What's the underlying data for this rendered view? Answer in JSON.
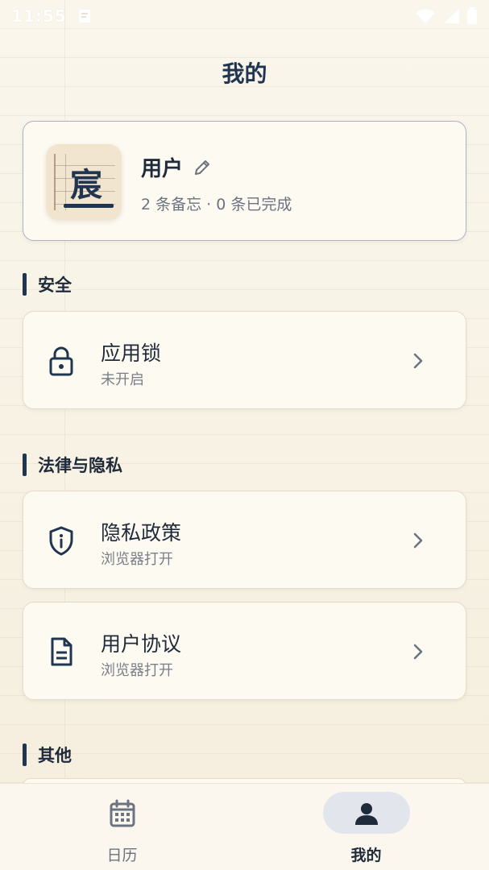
{
  "status_bar": {
    "time": "11:55"
  },
  "header": {
    "title": "我的"
  },
  "profile": {
    "avatar_char": "宸",
    "name": "用户",
    "stats": "2 条备忘 · 0 条已完成"
  },
  "sections": {
    "security": {
      "label": "安全",
      "items": [
        {
          "title": "应用锁",
          "subtitle": "未开启",
          "icon": "lock-icon"
        }
      ]
    },
    "legal": {
      "label": "法律与隐私",
      "items": [
        {
          "title": "隐私政策",
          "subtitle": "浏览器打开",
          "icon": "shield-info-icon"
        },
        {
          "title": "用户协议",
          "subtitle": "浏览器打开",
          "icon": "document-icon"
        }
      ]
    },
    "other": {
      "label": "其他"
    }
  },
  "bottom_nav": {
    "items": [
      {
        "label": "日历",
        "icon": "calendar-icon",
        "active": false
      },
      {
        "label": "我的",
        "icon": "person-icon",
        "active": true
      }
    ]
  },
  "colors": {
    "accent": "#1f3550",
    "background": "#f8f3e6",
    "card": "#fdfaf2"
  }
}
